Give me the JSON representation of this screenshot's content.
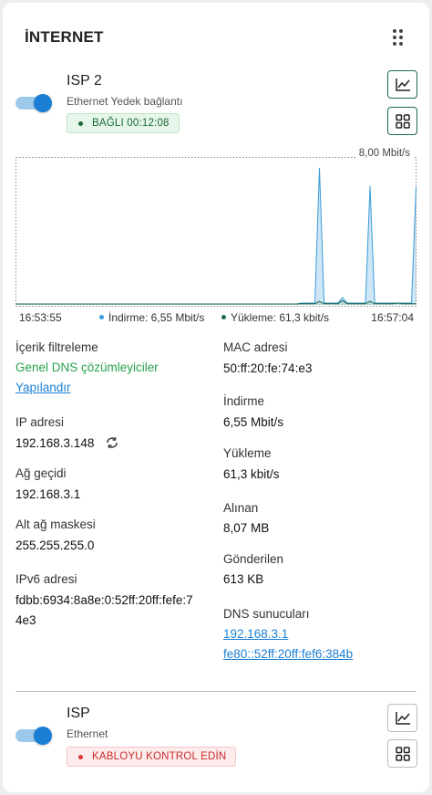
{
  "widget": {
    "title": "İNTERNET",
    "drag_icon": "drag-handle-icon"
  },
  "isp2": {
    "name": "ISP 2",
    "type": "Ethernet Yedek bağlantı",
    "enabled": true,
    "status": "BAĞLI 00:12:08",
    "status_color": "#1b6b36"
  },
  "chart_data": {
    "type": "area",
    "max_label": "8,00 Mbit/s",
    "ylim": [
      0,
      8.0
    ],
    "x_start": "16:53:55",
    "x_end": "16:57:04",
    "series": [
      {
        "name": "İndirme: 6,55 Mbit/s",
        "color": "#3a9ad9",
        "values": [
          0.05,
          0.05,
          0.05,
          0.05,
          0.05,
          0.05,
          0.05,
          0.05,
          0.05,
          0.05,
          0.05,
          0.05,
          0.05,
          0.05,
          0.05,
          0.05,
          0.05,
          0.05,
          0.05,
          0.05,
          0.05,
          0.05,
          0.05,
          0.05,
          0.05,
          0.05,
          0.05,
          0.05,
          0.05,
          0.05,
          0.05,
          0.05,
          0.05,
          0.05,
          0.05,
          0.05,
          0.05,
          0.05,
          0.05,
          0.05,
          0.05,
          0.05,
          0.05,
          0.05,
          0.05,
          0.05,
          0.05,
          0.05,
          0.05,
          0.05,
          0.05,
          0.05,
          0.05,
          0.05,
          0.05,
          0.05,
          0.05,
          0.05,
          0.05,
          0.05,
          0.05,
          0.05,
          0.1,
          0.1,
          0.1,
          0.1,
          7.6,
          0.1,
          0.1,
          0.1,
          0.1,
          0.4,
          0.1,
          0.1,
          0.1,
          0.1,
          0.1,
          6.6,
          0.1,
          0.1,
          0.1,
          0.1,
          0.1,
          0.1,
          0.1,
          0.1,
          0.1,
          6.55
        ]
      },
      {
        "name": "Yükleme: 61,3 kbit/s",
        "color": "#1e6b44",
        "values": [
          0.05,
          0.05,
          0.05,
          0.05,
          0.05,
          0.05,
          0.05,
          0.05,
          0.05,
          0.05,
          0.05,
          0.05,
          0.05,
          0.05,
          0.05,
          0.05,
          0.05,
          0.05,
          0.05,
          0.05,
          0.05,
          0.05,
          0.05,
          0.05,
          0.05,
          0.05,
          0.05,
          0.05,
          0.05,
          0.05,
          0.05,
          0.05,
          0.05,
          0.05,
          0.05,
          0.05,
          0.05,
          0.05,
          0.05,
          0.05,
          0.05,
          0.05,
          0.05,
          0.05,
          0.05,
          0.05,
          0.05,
          0.05,
          0.05,
          0.05,
          0.05,
          0.05,
          0.05,
          0.05,
          0.05,
          0.05,
          0.05,
          0.05,
          0.05,
          0.05,
          0.05,
          0.05,
          0.06,
          0.06,
          0.06,
          0.06,
          0.2,
          0.06,
          0.06,
          0.06,
          0.06,
          0.25,
          0.06,
          0.06,
          0.06,
          0.06,
          0.06,
          0.2,
          0.06,
          0.06,
          0.06,
          0.06,
          0.06,
          0.1,
          0.06,
          0.06,
          0.06,
          0.06
        ]
      }
    ]
  },
  "details": {
    "content_filter_label": "İçerik filtreleme",
    "content_filter_value": "Genel DNS çözümleyiciler",
    "configure_link": "Yapılandır",
    "ip_label": "IP adresi",
    "ip_value": "192.168.3.148",
    "gateway_label": "Ağ geçidi",
    "gateway_value": "192.168.3.1",
    "subnet_label": "Alt ağ maskesi",
    "subnet_value": "255.255.255.0",
    "ipv6_label": "IPv6 adresi",
    "ipv6_line1": "fdbb:6934:8a8e:0:52ff:20ff:fefe:7",
    "ipv6_line2": "4e3",
    "mac_label": "MAC adresi",
    "mac_value": "50:ff:20:fe:74:e3",
    "download_label": "İndirme",
    "download_value": "6,55 Mbit/s",
    "upload_label": "Yükleme",
    "upload_value": "61,3 kbit/s",
    "received_label": "Alınan",
    "received_value": "8,07 MB",
    "sent_label": "Gönderilen",
    "sent_value": "613 KB",
    "dns_label": "DNS sunucuları",
    "dns_servers": [
      "192.168.3.1",
      "fe80::52ff:20ff:fef6:384b"
    ]
  },
  "isp1": {
    "name": "ISP",
    "type": "Ethernet",
    "enabled": true,
    "status": "KABLOYU KONTROL EDİN",
    "status_color": "#c92a2a"
  }
}
